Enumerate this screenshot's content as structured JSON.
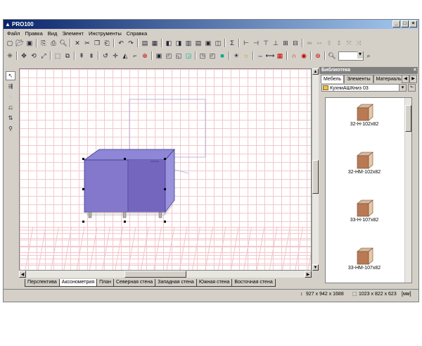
{
  "window": {
    "title": "PRO100",
    "min_label": "_",
    "max_label": "□",
    "close_label": "×"
  },
  "menu": [
    "Файл",
    "Правка",
    "Вид",
    "Элемент",
    "Инструменты",
    "Справка"
  ],
  "zoom_value": "",
  "view_tabs": [
    "Перспектива",
    "Аксонометрия",
    "План",
    "Северная стена",
    "Западная стена",
    "Южная стена",
    "Восточная стена"
  ],
  "active_view_tab": "Аксонометрия",
  "library": {
    "panel_title": "Библиотека",
    "tabs": [
      "Мебель",
      "Элементы",
      "Материалы"
    ],
    "folder": "КухниАШКниз 03",
    "items": [
      {
        "label": "32-Н-102x82"
      },
      {
        "label": "32-НМ-102x82"
      },
      {
        "label": "33-Н-107x82"
      },
      {
        "label": "33-НМ-107x82"
      }
    ]
  },
  "status": {
    "dims1": "927 x 942 x 1688",
    "dims2": "1023 x 822 x 623",
    "units": "[мм]"
  }
}
